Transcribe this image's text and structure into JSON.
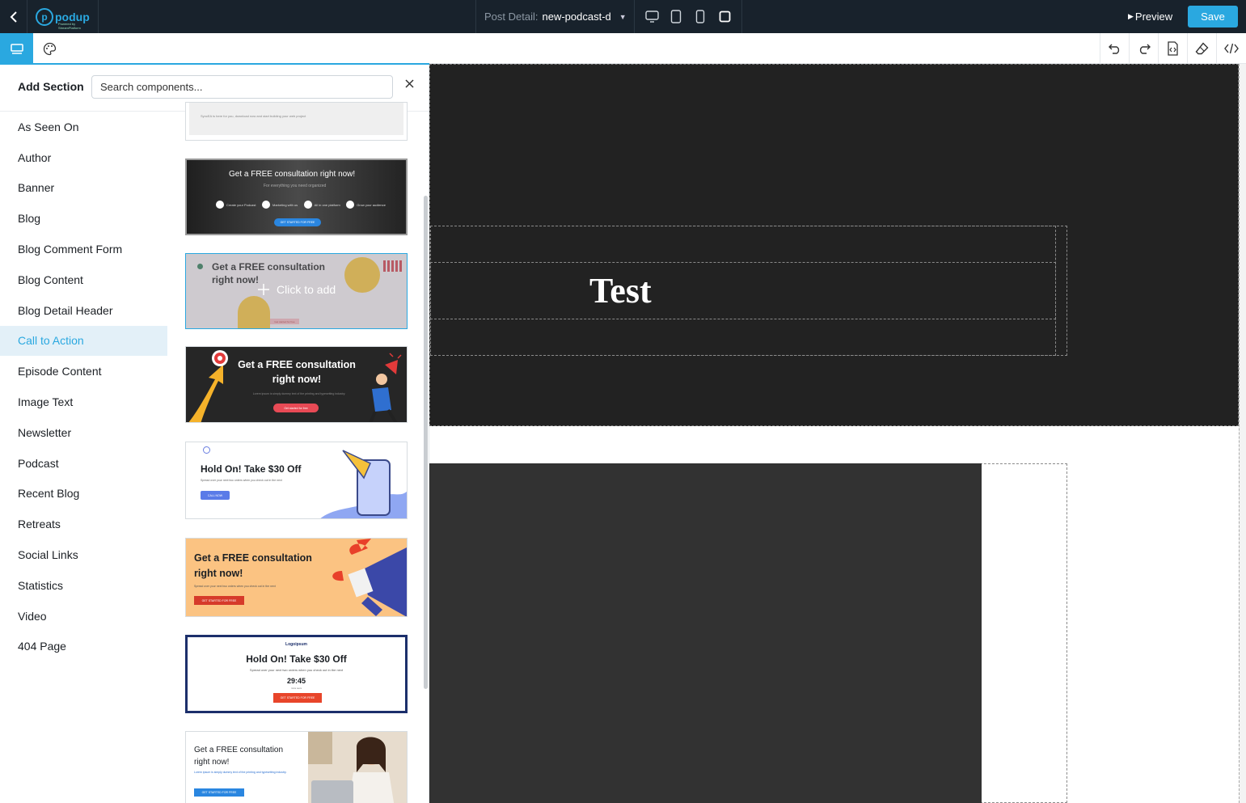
{
  "app": {
    "logo_text": "podup",
    "logo_sub": "Powered by StreamPlatform",
    "post_label": "Post Detail:",
    "post_value": "new-podcast-d",
    "preview_label": "Preview",
    "save_label": "Save",
    "accent_color": "#2aa8e0"
  },
  "panel": {
    "title": "Add Section",
    "search_placeholder": "Search components...",
    "categories": [
      "As Seen On",
      "Author",
      "Banner",
      "Blog",
      "Blog Comment Form",
      "Blog Content",
      "Blog Detail Header",
      "Call to Action",
      "Episode Content",
      "Image Text",
      "Newsletter",
      "Podcast",
      "Recent Blog",
      "Retreats",
      "Social Links",
      "Statistics",
      "Video",
      "404 Page"
    ],
    "active_category": "Call to Action"
  },
  "thumbnails": {
    "t0_text": "SyncEA is here for you, download now and start building your web project",
    "t1_title": "Get a FREE consultation right now!",
    "t1_sub": "For everything you need organized",
    "t1_f1": "Create your Podcast",
    "t1_f2": "Marketing with us",
    "t1_f3": "All in one platform",
    "t1_f4": "Grow your audience",
    "t1_btn": "GET STARTED FOR FREE",
    "t2_title": "Get a FREE consultation right now!",
    "t2_hover": "Click to add",
    "t2_btn": "Get started for free",
    "t3_title": "Get a FREE consultation right now!",
    "t3_sub": "Lorem ipsum is simply dummy text of the printing and typesetting industry.",
    "t3_btn": "Get started for free",
    "t4_title": "Hold On! Take $30 Off",
    "t4_sub": "Spread over your next two orders when you check out in the next",
    "t4_btn": "CALL NOW",
    "t5_title": "Get a FREE consultation right now!",
    "t5_sub": "Spread over your next two orders when you check out in the next",
    "t5_btn": "GET STARTED FOR FREE",
    "t6_logo": "Logoipsum",
    "t6_title": "Hold On! Take $30 Off",
    "t6_sub": "Spread over your next two orders when you check out in the next",
    "t6_timer": "29:45",
    "t6_timer_sub": "mins secs",
    "t6_btn": "GET STARTED FOR FREE",
    "t7_title": "Get a FREE consultation right now!",
    "t7_sub": "Lorem ipsum is simply dummy text of the printing and typesetting industry.",
    "t7_btn": "GET STARTED FOR FREE"
  },
  "canvas": {
    "heading": "Test"
  }
}
